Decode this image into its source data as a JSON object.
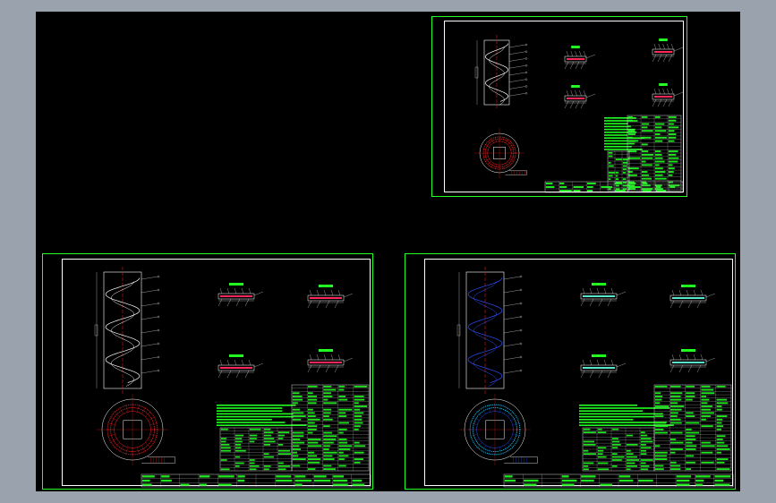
{
  "app": {
    "window_title": ""
  },
  "colors": {
    "background": "#000000",
    "frame": "#22ff22",
    "inner_border": "#ffffff",
    "accent_red": "#ff2020",
    "accent_magenta": "#ff40ff",
    "accent_blue": "#3050ff",
    "accent_cyan": "#20e0ff",
    "accent_yellow": "#ffff40",
    "text_green": "#22ff22"
  },
  "sheets": [
    {
      "id": "sheet-small",
      "variant": "red",
      "label": ""
    },
    {
      "id": "sheet-left",
      "variant": "red",
      "label": ""
    },
    {
      "id": "sheet-right",
      "variant": "blue",
      "label": ""
    }
  ],
  "icons": [
    "spiral-chute-elevation-icon",
    "spiral-plan-view-icon",
    "section-detail-icon",
    "parts-table-icon",
    "title-block-icon"
  ]
}
